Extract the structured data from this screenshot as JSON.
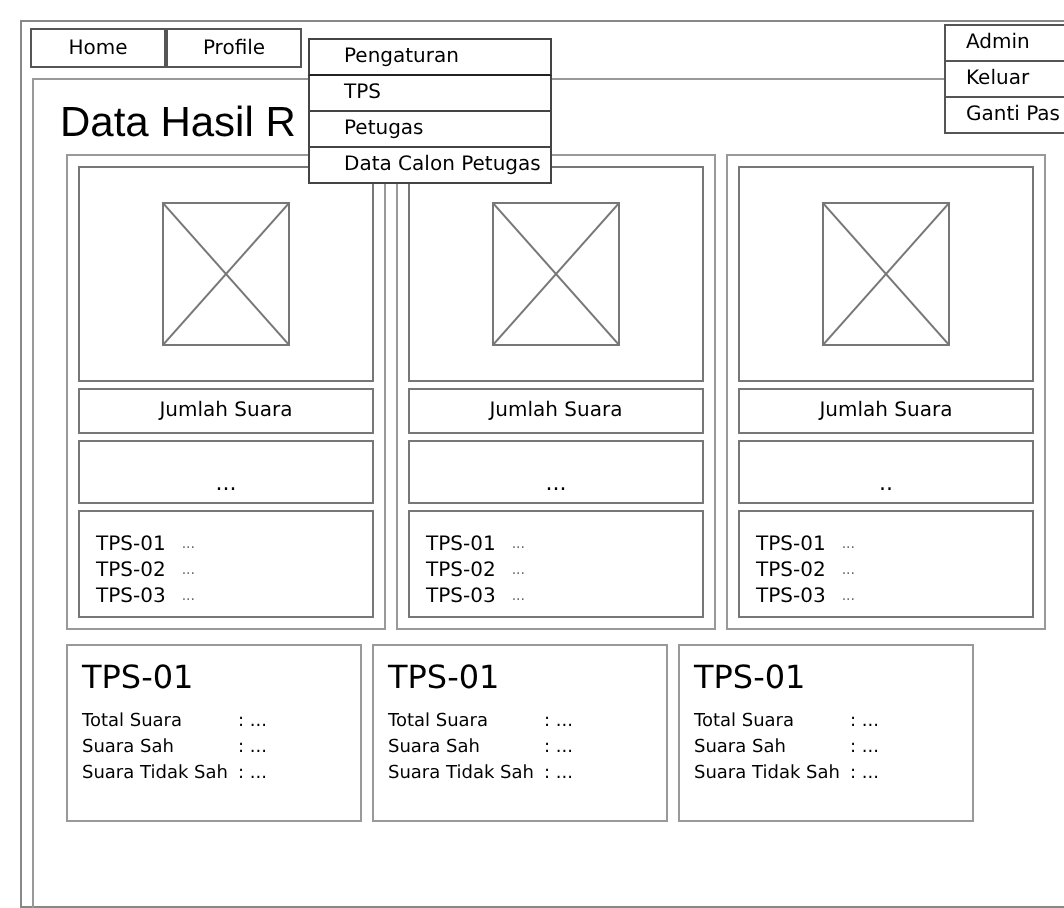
{
  "nav": [
    {
      "label": "Home"
    },
    {
      "label": "Profile"
    }
  ],
  "settings_menu": {
    "label": "Pengaturan",
    "expanded": true,
    "items": [
      "TPS",
      "Petugas",
      "Data Calon Petugas"
    ]
  },
  "user_menu": {
    "label": "Admin",
    "items": [
      "Keluar",
      "Ganti Pas"
    ]
  },
  "title": "Data Hasil R",
  "cards": [
    {
      "caption": "Jumlah Suara",
      "value": "...",
      "rows": [
        {
          "name": "TPS-01",
          "value": "..."
        },
        {
          "name": "TPS-02",
          "value": "..."
        },
        {
          "name": "TPS-03",
          "value": "..."
        }
      ]
    },
    {
      "caption": "Jumlah Suara",
      "value": "...",
      "rows": [
        {
          "name": "TPS-01",
          "value": "..."
        },
        {
          "name": "TPS-02",
          "value": "..."
        },
        {
          "name": "TPS-03",
          "value": "..."
        }
      ]
    },
    {
      "caption": "Jumlah Suara",
      "value": "..",
      "rows": [
        {
          "name": "TPS-01",
          "value": "..."
        },
        {
          "name": "TPS-02",
          "value": "..."
        },
        {
          "name": "TPS-03",
          "value": "..."
        }
      ]
    }
  ],
  "summaries": [
    {
      "title": "TPS-01",
      "rows": [
        {
          "label": "Total Suara",
          "value": ": ..."
        },
        {
          "label": "Suara Sah",
          "value": ": ..."
        },
        {
          "label": "Suara Tidak Sah",
          "value": ": ..."
        }
      ]
    },
    {
      "title": "TPS-01",
      "rows": [
        {
          "label": "Total Suara",
          "value": ": ..."
        },
        {
          "label": "Suara Sah",
          "value": ": ..."
        },
        {
          "label": "Suara Tidak Sah",
          "value": ": ..."
        }
      ]
    },
    {
      "title": "TPS-01",
      "rows": [
        {
          "label": "Total Suara",
          "value": ": ..."
        },
        {
          "label": "Suara Sah",
          "value": ": ..."
        },
        {
          "label": "Suara Tidak Sah",
          "value": ": ..."
        }
      ]
    }
  ]
}
